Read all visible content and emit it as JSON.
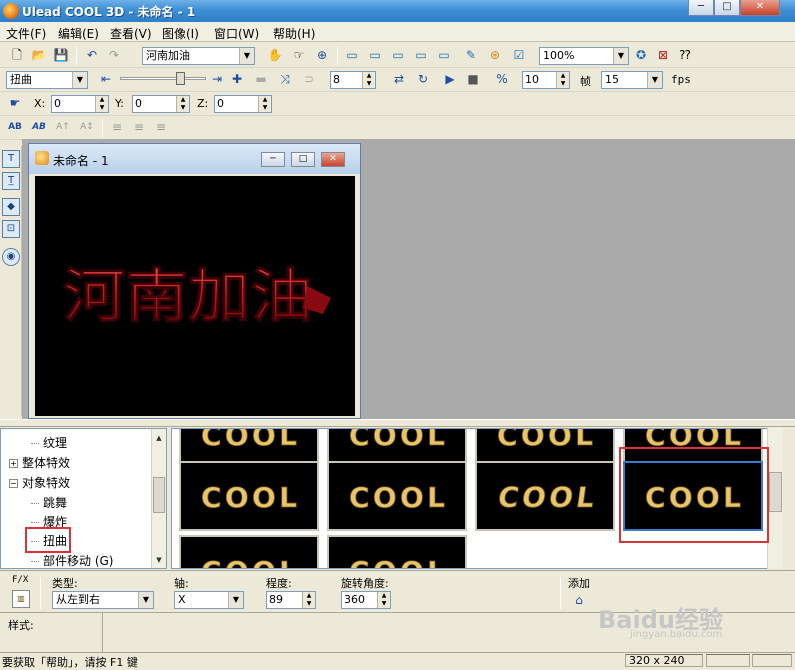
{
  "window": {
    "title": "Ulead COOL 3D - 未命名 - 1",
    "minimize": "─",
    "maximize": "□",
    "close": "✕"
  },
  "menu": [
    "文件(F)",
    "编辑(E)",
    "查看(V)",
    "图像(I)",
    "窗口(W)",
    "帮助(H)"
  ],
  "toolbar1": {
    "text_object": "河南加油",
    "zoom": "100%"
  },
  "toolbar2": {
    "effect_type": "扭曲",
    "frame_value": "8",
    "fps_value1": "10",
    "frame_label": "帧",
    "fps_value2": "15",
    "fps_label": "fps"
  },
  "toolbar3": {
    "x_label": "X:",
    "x_value": "0",
    "y_label": "Y:",
    "y_value": "0",
    "z_label": "Z:",
    "z_value": "0"
  },
  "toolbar4": {
    "items": [
      "AB",
      "AB",
      "A↑",
      "A↕"
    ]
  },
  "document": {
    "title": "未命名 - 1",
    "canvas_text": "河南加油",
    "text_color": "#d4202a"
  },
  "tree": {
    "items": [
      {
        "label": "纹理",
        "indent": 2,
        "expander": ""
      },
      {
        "label": "整体特效",
        "indent": 0,
        "expander": "+"
      },
      {
        "label": "对象特效",
        "indent": 0,
        "expander": "−"
      },
      {
        "label": "跳舞",
        "indent": 2,
        "expander": ""
      },
      {
        "label": "爆炸",
        "indent": 2,
        "expander": ""
      },
      {
        "label": "扭曲",
        "indent": 2,
        "expander": "",
        "selected": true
      },
      {
        "label": "部件移动 (G)",
        "indent": 2,
        "expander": ""
      }
    ]
  },
  "gallery": {
    "thumb_text": "COOL",
    "gold": "#e8c46a",
    "selected_index": 3
  },
  "properties": {
    "fx_label": "F/X",
    "type_label": "类型:",
    "type_value": "从左到右",
    "axis_label": "轴:",
    "axis_value": "X",
    "degree_label": "程度:",
    "degree_value": "89",
    "angle_label": "旋转角度:",
    "angle_value": "360",
    "add_label": "添加"
  },
  "style": {
    "label": "样式:"
  },
  "status": {
    "help_text": "要获取「帮助」，请按 F1 键",
    "size": "320 x 240"
  },
  "watermark": {
    "brand": "Baidu经验",
    "url": "jingyan.baidu.com"
  }
}
